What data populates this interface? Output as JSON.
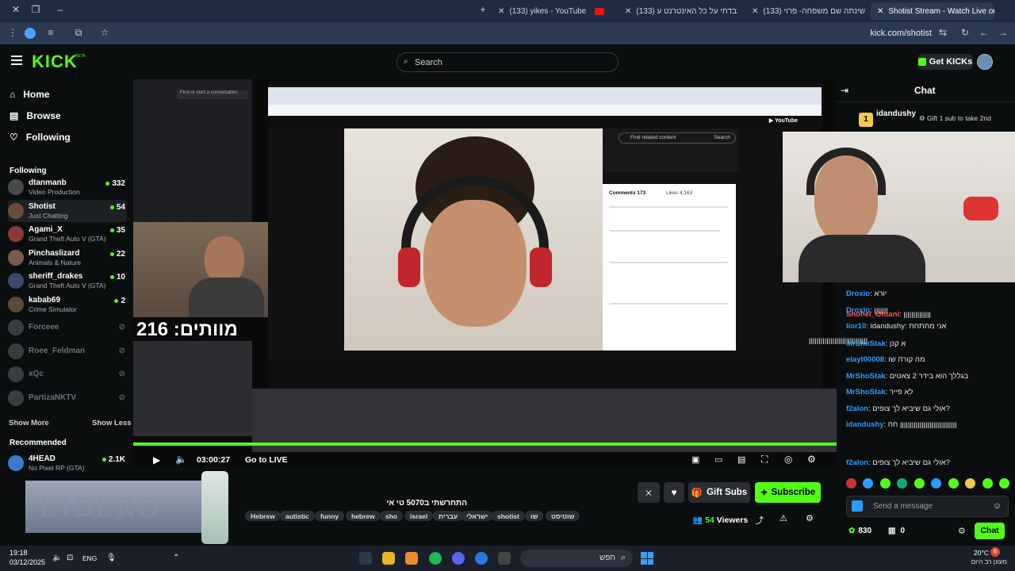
{
  "browser": {
    "tabs": [
      {
        "title": "(133) yikes - YouTube"
      },
      {
        "title": "(133) עבדתי על כל האינטרנט ע..."
      },
      {
        "title": "(133) שינתה שם משפחה- פרוי"
      },
      {
        "title": "Shotist Stream - Watch Live on"
      }
    ],
    "url": "kick.com/shotist"
  },
  "header": {
    "logo": "KICK",
    "logo_badge": "BETA",
    "search_placeholder": "Search",
    "get_kicks": "Get KICKs"
  },
  "sidebar": {
    "nav": [
      {
        "label": "Home",
        "icon": "home-icon"
      },
      {
        "label": "Browse",
        "icon": "browse-icon"
      },
      {
        "label": "Following",
        "icon": "heart-icon"
      }
    ],
    "following_title": "Following",
    "following": [
      {
        "name": "dtanmanb",
        "category": "Video Production",
        "viewers": "332"
      },
      {
        "name": "Shotist",
        "category": "Just Chatting",
        "viewers": "54"
      },
      {
        "name": "Agami_X",
        "category": "Grand Theft Auto V (GTA)",
        "viewers": "35"
      },
      {
        "name": "Pinchaslizard",
        "category": "Animals & Nature",
        "viewers": "22"
      },
      {
        "name": "sheriff_drakes",
        "category": "Grand Theft Auto V (GTA)",
        "viewers": "10"
      },
      {
        "name": "kabab69",
        "category": "Crime Simulator",
        "viewers": "2"
      },
      {
        "name": "Forceee",
        "category": "",
        "viewers": ""
      },
      {
        "name": "Roee_Feldman",
        "category": "",
        "viewers": ""
      },
      {
        "name": "xQc",
        "category": "",
        "viewers": ""
      },
      {
        "name": "PartizaNKTV",
        "category": "",
        "viewers": ""
      }
    ],
    "show_more": "Show More",
    "show_less": "Show Less",
    "recommended_title": "Recommended",
    "recommended": [
      {
        "name": "4HEAD",
        "category": "No Pixel RP (GTA)",
        "viewers": "2.1K"
      }
    ]
  },
  "video": {
    "overlay_text": "מוותים: 216",
    "time": "03:00:27",
    "go_live": "Go to LIVE",
    "comments_label": "Comments 173",
    "likes_label": "Likes 4,163",
    "related_search": "Find related content",
    "search_btn": "Search",
    "progress": 1.0
  },
  "stream_info": {
    "title": "התחרשתי ב5070 טי אי",
    "tags": [
      "Hebrew",
      "autistic",
      "funny",
      "hebrew",
      "sho",
      "israel",
      "עברית",
      "ישראלי",
      "shotist",
      "שו",
      "שוטיסט"
    ],
    "gift_subs": "Gift Subs",
    "subscribe": "Subscribe",
    "viewers": "54",
    "viewers_label": "Viewers"
  },
  "chat": {
    "title": "Chat",
    "pinned_user": "idandushy",
    "pinned_rank": "1",
    "gift_text": "Gift 1 sub to take 2nd",
    "messages": [
      {
        "user": "Droxio",
        "text": "יורא"
      },
      {
        "user": "Droxio",
        "text": "ןןןןןןן"
      },
      {
        "user": "Shohei_Ohtani",
        "text": "ןןןןןןןןןןןןןן"
      },
      {
        "user": "lior10",
        "text": "idandushy: אני מתתחת"
      },
      {
        "user": "",
        "text": "ןןןןןןןןןןןןןןןןןןןןןןןןןןןןןן"
      },
      {
        "user": "MrShoStak",
        "text": "א קנן"
      },
      {
        "user": "elayt00008",
        "text": "מה קורה שו"
      },
      {
        "user": "MrShoStak",
        "text": "בגללך הוא בידר 2 צאטים"
      },
      {
        "user": "MrShoStak",
        "text": "לא פייר"
      },
      {
        "user": "f2alon",
        "text": "אולי גם שיביא לך צופים?"
      },
      {
        "user": "idandushy",
        "text": "ןןןןןןןןןןןןןןןןןןןןןןןןןןןןן חח"
      },
      {
        "user": "f2alon",
        "text": "אולי גם שיביא לך צופים?"
      }
    ],
    "input_placeholder": "Send a message",
    "points": "830",
    "other_count": "0",
    "chat_button": "Chat"
  },
  "taskbar": {
    "time": "19:18",
    "date": "03/12/2025",
    "lang": "ENG",
    "search_placeholder": "חפש",
    "temp": "20°C",
    "weather": "מעונן רב היום",
    "notif": "6"
  }
}
